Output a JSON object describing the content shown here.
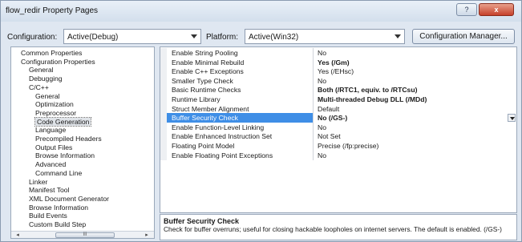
{
  "window": {
    "title": "flow_redir Property Pages",
    "help_label": "?",
    "close_label": "x"
  },
  "toolbar": {
    "configuration_label": "Configuration:",
    "configuration_value": "Active(Debug)",
    "platform_label": "Platform:",
    "platform_value": "Active(Win32)",
    "config_manager_label": "Configuration Manager..."
  },
  "tree": {
    "items": [
      {
        "label": "Common Properties",
        "level": 1
      },
      {
        "label": "Configuration Properties",
        "level": 1
      },
      {
        "label": "General",
        "level": 2
      },
      {
        "label": "Debugging",
        "level": 2
      },
      {
        "label": "C/C++",
        "level": 2
      },
      {
        "label": "General",
        "level": 3
      },
      {
        "label": "Optimization",
        "level": 3
      },
      {
        "label": "Preprocessor",
        "level": 3
      },
      {
        "label": "Code Generation",
        "level": 3,
        "selected": true
      },
      {
        "label": "Language",
        "level": 3
      },
      {
        "label": "Precompiled Headers",
        "level": 3
      },
      {
        "label": "Output Files",
        "level": 3
      },
      {
        "label": "Browse Information",
        "level": 3
      },
      {
        "label": "Advanced",
        "level": 3
      },
      {
        "label": "Command Line",
        "level": 3
      },
      {
        "label": "Linker",
        "level": 2
      },
      {
        "label": "Manifest Tool",
        "level": 2
      },
      {
        "label": "XML Document Generator",
        "level": 2
      },
      {
        "label": "Browse Information",
        "level": 2
      },
      {
        "label": "Build Events",
        "level": 2
      },
      {
        "label": "Custom Build Step",
        "level": 2
      }
    ],
    "scroll_left": "◂",
    "scroll_right": "▸",
    "scroll_thumb": "III"
  },
  "grid": {
    "rows": [
      {
        "name": "Enable String Pooling",
        "value": "No",
        "bold": false
      },
      {
        "name": "Enable Minimal Rebuild",
        "value": "Yes (/Gm)",
        "bold": true
      },
      {
        "name": "Enable C++ Exceptions",
        "value": "Yes (/EHsc)",
        "bold": false
      },
      {
        "name": "Smaller Type Check",
        "value": "No",
        "bold": false
      },
      {
        "name": "Basic Runtime Checks",
        "value": "Both (/RTC1, equiv. to /RTCsu)",
        "bold": true
      },
      {
        "name": "Runtime Library",
        "value": "Multi-threaded Debug DLL (/MDd)",
        "bold": true
      },
      {
        "name": "Struct Member Alignment",
        "value": "Default",
        "bold": false
      },
      {
        "name": "Buffer Security Check",
        "value": "No (/GS-)",
        "bold": true,
        "selected": true
      },
      {
        "name": "Enable Function-Level Linking",
        "value": "No",
        "bold": false
      },
      {
        "name": "Enable Enhanced Instruction Set",
        "value": "Not Set",
        "bold": false
      },
      {
        "name": "Floating Point Model",
        "value": "Precise (/fp:precise)",
        "bold": false
      },
      {
        "name": "Enable Floating Point Exceptions",
        "value": "No",
        "bold": false
      }
    ]
  },
  "description": {
    "title": "Buffer Security Check",
    "text": "Check for buffer overruns; useful for closing hackable loopholes on internet servers.  The default is enabled.   (/GS-)"
  }
}
